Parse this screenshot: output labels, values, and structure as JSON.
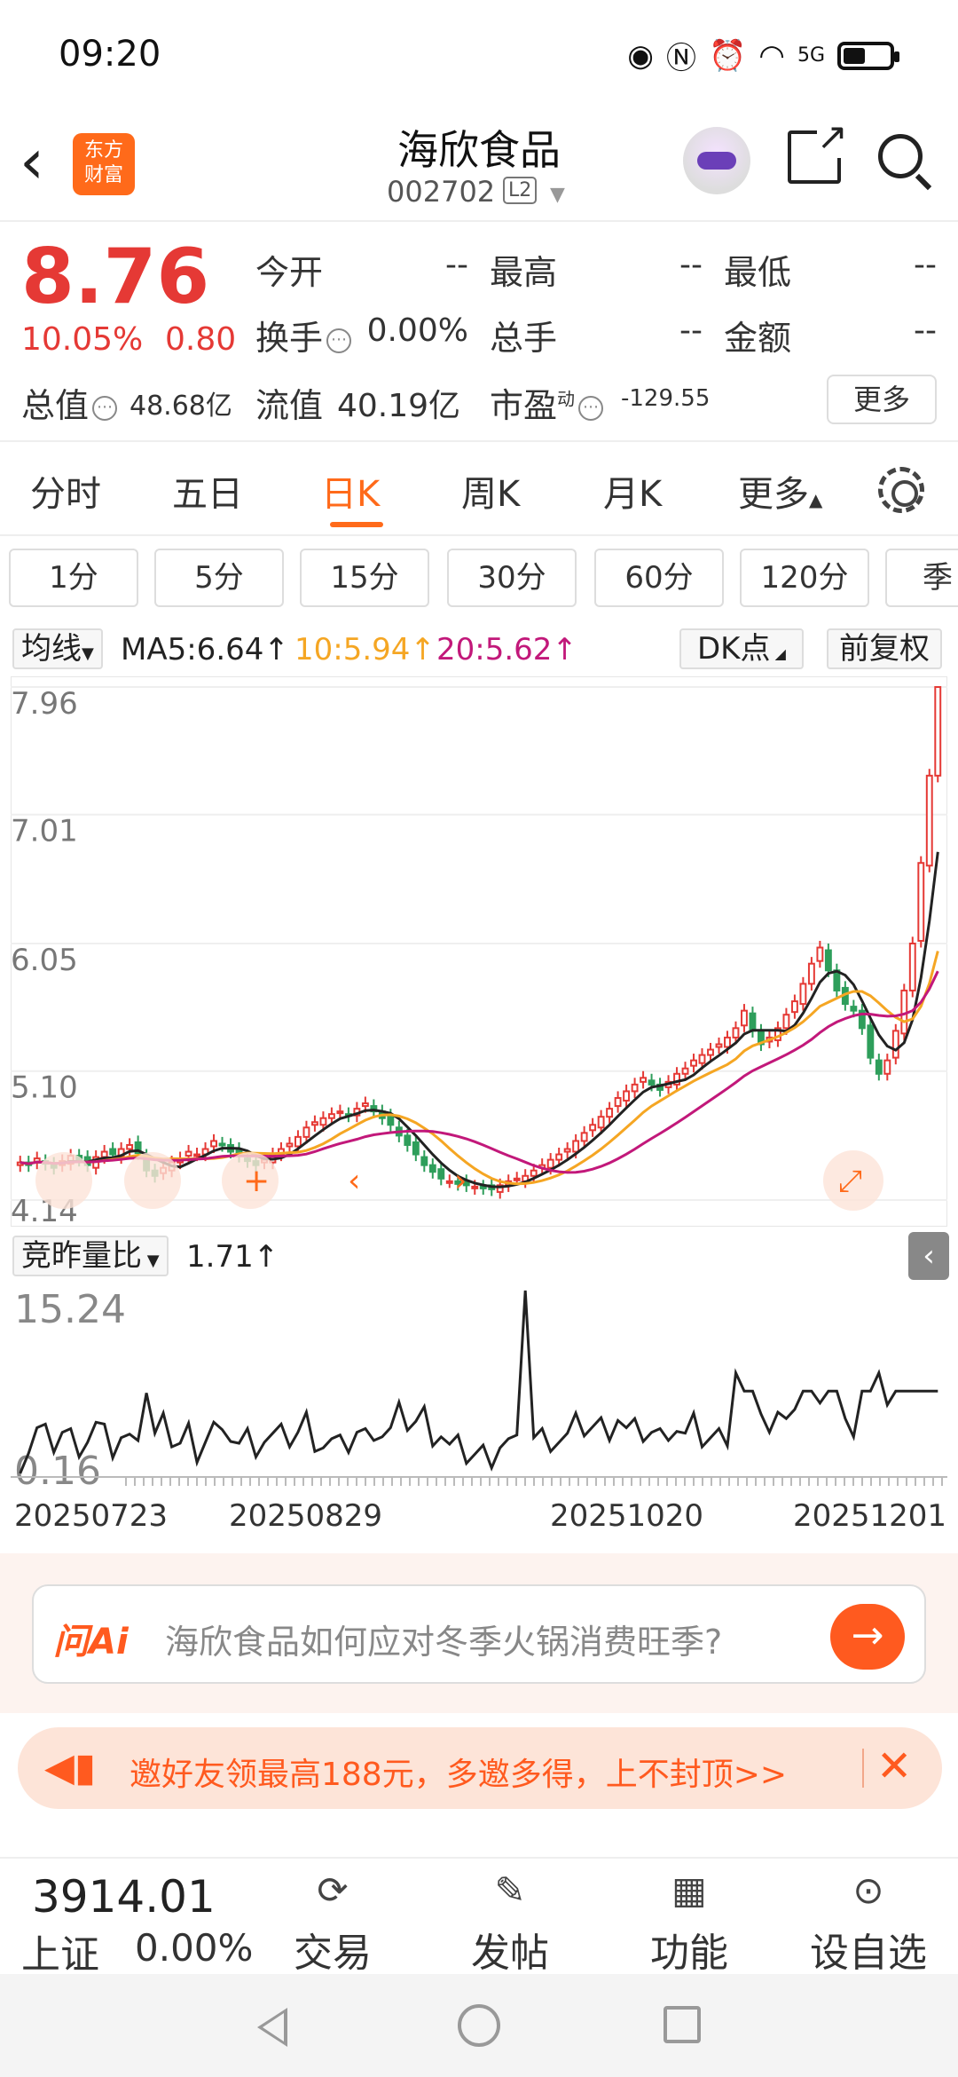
{
  "status_bar": {
    "time": "09:20",
    "network": "5G"
  },
  "header": {
    "logo_line1": "东方",
    "logo_line2": "财富",
    "title": "海欣食品",
    "code": "002702",
    "level": "L2"
  },
  "quote": {
    "price": "8.76",
    "change_pct": "10.05%",
    "change_val": "0.80",
    "open_label": "今开",
    "open_val": "--",
    "high_label": "最高",
    "high_val": "--",
    "low_label": "最低",
    "low_val": "--",
    "turnover_label": "换手",
    "turnover_val": "0.00%",
    "volume_label": "总手",
    "volume_val": "--",
    "amount_label": "金额",
    "amount_val": "--",
    "mktcap_label": "总值",
    "mktcap_val": "48.68亿",
    "float_label": "流值",
    "float_val": "40.19亿",
    "pe_label": "市盈",
    "pe_sup": "动",
    "pe_val": "-129.55",
    "more_label": "更多"
  },
  "period_tabs": [
    "分时",
    "五日",
    "日K",
    "周K",
    "月K",
    "更多"
  ],
  "active_tab": "日K",
  "minute_chips": [
    "1分",
    "5分",
    "15分",
    "30分",
    "60分",
    "120分",
    "季"
  ],
  "indicators": {
    "ma_select": "均线",
    "ma5": "MA5:6.64↑",
    "ma10": "10:5.94↑",
    "ma20": "20:5.62↑",
    "dk": "DK点",
    "adjust": "前复权"
  },
  "colors": {
    "up": "#e53935",
    "down": "#2e9e5b",
    "accent": "#ff6a1a",
    "ma5": "#222222",
    "ma10": "#f5a623",
    "ma20": "#c2187a"
  },
  "chart_data": {
    "type": "candlestick",
    "y_ticks": [
      "7.96",
      "7.01",
      "6.05",
      "5.10",
      "4.14"
    ],
    "ylim": [
      4.14,
      7.96
    ],
    "x_ticks": [
      "20250723",
      "20250829",
      "20251020",
      "20251201"
    ],
    "closes": [
      4.42,
      4.4,
      4.45,
      4.41,
      4.38,
      4.43,
      4.47,
      4.44,
      4.4,
      4.46,
      4.5,
      4.48,
      4.52,
      4.55,
      4.49,
      4.36,
      4.32,
      4.38,
      4.42,
      4.45,
      4.5,
      4.48,
      4.52,
      4.58,
      4.55,
      4.5,
      4.47,
      4.43,
      4.4,
      4.44,
      4.48,
      4.52,
      4.56,
      4.61,
      4.68,
      4.72,
      4.75,
      4.78,
      4.8,
      4.77,
      4.82,
      4.86,
      4.8,
      4.75,
      4.7,
      4.62,
      4.55,
      4.48,
      4.4,
      4.35,
      4.3,
      4.28,
      4.26,
      4.25,
      4.24,
      4.23,
      4.22,
      4.25,
      4.28,
      4.3,
      4.32,
      4.36,
      4.4,
      4.44,
      4.48,
      4.52,
      4.58,
      4.64,
      4.7,
      4.76,
      4.82,
      4.9,
      4.95,
      5.0,
      5.05,
      5.0,
      4.96,
      5.02,
      5.08,
      5.12,
      5.18,
      5.22,
      5.26,
      5.3,
      5.35,
      5.42,
      5.55,
      5.4,
      5.3,
      5.35,
      5.42,
      5.52,
      5.62,
      5.75,
      5.9,
      6.02,
      5.85,
      5.7,
      5.6,
      5.55,
      5.42,
      5.2,
      5.08,
      5.18,
      5.4,
      5.7,
      6.05,
      6.65,
      7.3,
      7.96
    ],
    "volume_ratio": {
      "current": "1.71↑",
      "max": "15.24",
      "min": "0.16"
    }
  },
  "vol_row": {
    "select": "竞昨量比",
    "value": "1.71↑"
  },
  "ai": {
    "logo": "问Ai",
    "prompt": "海欣食品如何应对冬季火锅消费旺季?"
  },
  "promo": {
    "text": "邀好友领最高188元，多邀多得，上不封顶>>"
  },
  "bottom": {
    "index_val": "3914.01",
    "index_name": "上证",
    "index_chg": "0.00%",
    "nav": [
      "交易",
      "发帖",
      "功能",
      "设自选"
    ]
  }
}
